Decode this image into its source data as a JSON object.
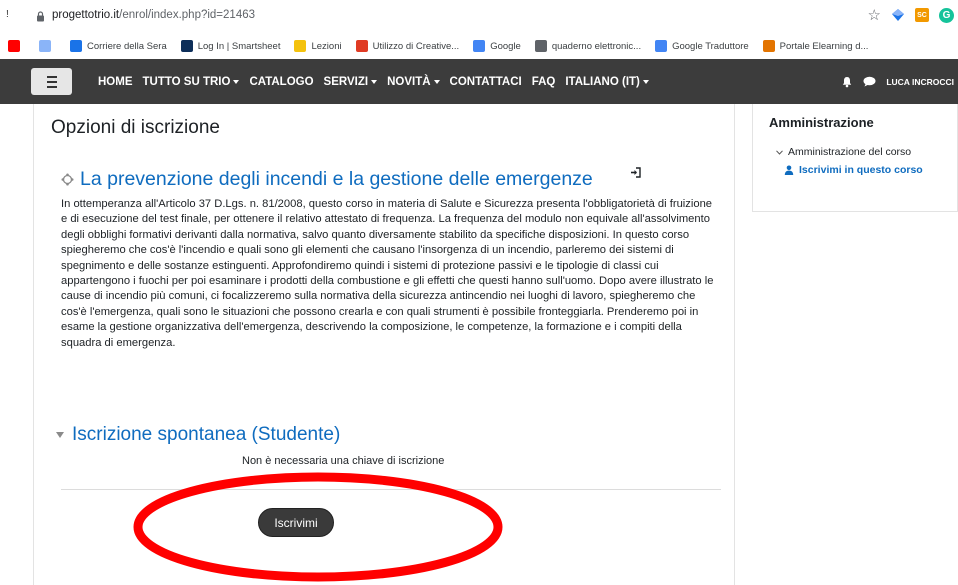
{
  "browser": {
    "addr_prefix": "!",
    "url_host": "progettotrio.it",
    "url_path": "/enrol/index.php?id=21463",
    "extension_sc": "SC",
    "extension_g": "G"
  },
  "bookmarks": [
    {
      "label": "",
      "icon": "youtube-icon",
      "color": "#ff0000"
    },
    {
      "label": "",
      "icon": "media-icon",
      "color": "#8ab4f8"
    },
    {
      "label": "Corriere della Sera",
      "icon": "corriere-icon",
      "color": "#1a73e8"
    },
    {
      "label": "Log In | Smartsheet",
      "icon": "smartsheet-icon",
      "color": "#0d2e59"
    },
    {
      "label": "Lezioni",
      "icon": "lezioni-icon",
      "color": "#f4c20d"
    },
    {
      "label": "Utilizzo di Creative...",
      "icon": "adobe-icon",
      "color": "#e03b24"
    },
    {
      "label": "Google",
      "icon": "google-icon",
      "color": "#4285f4"
    },
    {
      "label": "quaderno elettronic...",
      "icon": "globe-icon",
      "color": "#5f6368"
    },
    {
      "label": "Google Traduttore",
      "icon": "translate-icon",
      "color": "#4285f4"
    },
    {
      "label": "Portale Elearning d...",
      "icon": "portale-icon",
      "color": "#e37400"
    }
  ],
  "nav": {
    "items": [
      {
        "label": "HOME",
        "dropdown": false
      },
      {
        "label": "TUTTO SU TRIO",
        "dropdown": true
      },
      {
        "label": "CATALOGO",
        "dropdown": false
      },
      {
        "label": "SERVIZI",
        "dropdown": true
      },
      {
        "label": "NOVITÀ",
        "dropdown": true
      },
      {
        "label": "CONTATTACI",
        "dropdown": false
      },
      {
        "label": "FAQ",
        "dropdown": false
      },
      {
        "label": "ITALIANO (IT)",
        "dropdown": true
      }
    ],
    "user": "LUCA INCROCCI"
  },
  "main": {
    "page_title": "Opzioni di iscrizione",
    "course_title": "La prevenzione degli incendi e la gestione delle emergenze",
    "description": "In ottemperanza all'Articolo 37 D.Lgs. n. 81/2008, questo corso in materia di Salute e Sicurezza presenta l'obbligatorietà di fruizione e di esecuzione del test finale, per ottenere il relativo attestato di frequenza. La frequenza del modulo non equivale all'assolvimento degli obblighi formativi derivanti dalla normativa, salvo quanto diversamente stabilito da specifiche disposizioni. In questo corso spiegheremo che cos'è l'incendio e quali sono gli elementi che causano l'insorgenza di un incendio, parleremo dei sistemi di spegnimento e delle sostanze estinguenti. Approfondiremo quindi i sistemi di protezione passivi e le tipologie di classi cui appartengono i fuochi per poi esaminare i prodotti della combustione e gli effetti che questi hanno sull'uomo. Dopo avere illustrato le cause di incendio più comuni, ci focalizzeremo sulla normativa della sicurezza antincendio nei luoghi di lavoro, spiegheremo che cos'è l'emergenza, quali sono le situazioni che possono crearla e con quali strumenti è possibile fronteggiarla. Prenderemo poi in esame la gestione organizzativa dell'emergenza, descrivendo la composizione, le competenze, la formazione e i compiti della squadra di emergenza.",
    "section_title": "Iscrizione spontanea (Studente)",
    "no_key_text": "Non è necessaria una chiave di iscrizione",
    "enroll_button": "Iscrivimi"
  },
  "sidebar": {
    "title": "Amministrazione",
    "node": "Amministrazione del corso",
    "link": "Iscrivimi in questo corso"
  },
  "colors": {
    "link": "#0f6cbf",
    "navbar": "#3c3c3c",
    "annotation": "#ff0000"
  }
}
